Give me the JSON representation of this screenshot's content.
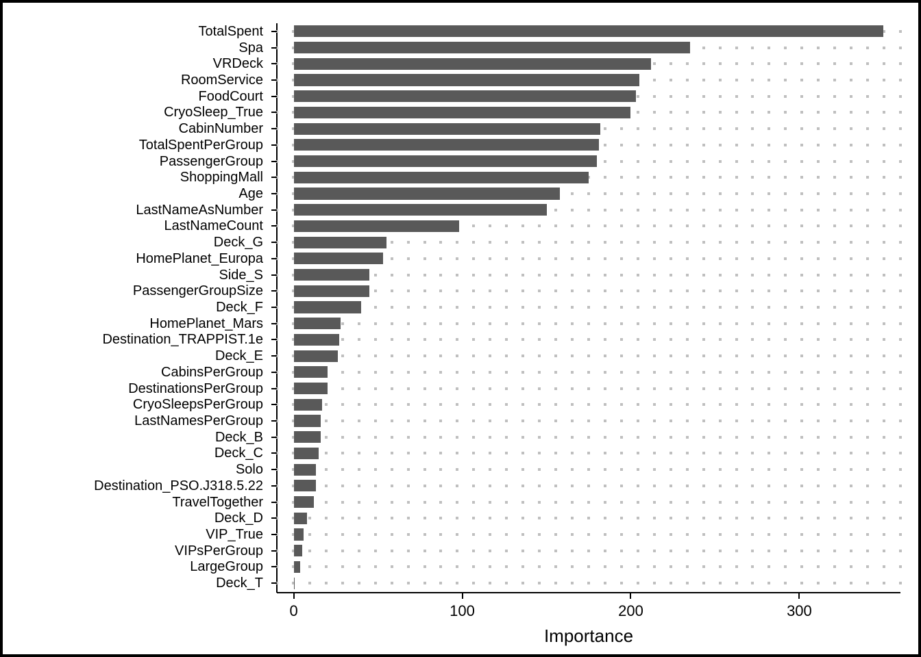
{
  "chart_data": {
    "type": "bar",
    "orientation": "horizontal",
    "xlabel": "Importance",
    "ylabel": "",
    "xlim": [
      -10,
      360
    ],
    "xticks": [
      0,
      100,
      200,
      300
    ],
    "grid": "dotted",
    "bar_color": "#595959",
    "categories": [
      "TotalSpent",
      "Spa",
      "VRDeck",
      "RoomService",
      "FoodCourt",
      "CryoSleep_True",
      "CabinNumber",
      "TotalSpentPerGroup",
      "PassengerGroup",
      "ShoppingMall",
      "Age",
      "LastNameAsNumber",
      "LastNameCount",
      "Deck_G",
      "HomePlanet_Europa",
      "Side_S",
      "PassengerGroupSize",
      "Deck_F",
      "HomePlanet_Mars",
      "Destination_TRAPPIST.1e",
      "Deck_E",
      "CabinsPerGroup",
      "DestinationsPerGroup",
      "CryoSleepsPerGroup",
      "LastNamesPerGroup",
      "Deck_B",
      "Deck_C",
      "Solo",
      "Destination_PSO.J318.5.22",
      "TravelTogether",
      "Deck_D",
      "VIP_True",
      "VIPsPerGroup",
      "LargeGroup",
      "Deck_T"
    ],
    "values": [
      350,
      235,
      212,
      205,
      203,
      200,
      182,
      181,
      180,
      175,
      158,
      150,
      98,
      55,
      53,
      45,
      45,
      40,
      28,
      27,
      26,
      20,
      20,
      17,
      16,
      16,
      15,
      13,
      13,
      12,
      8,
      6,
      5,
      4,
      0
    ]
  }
}
